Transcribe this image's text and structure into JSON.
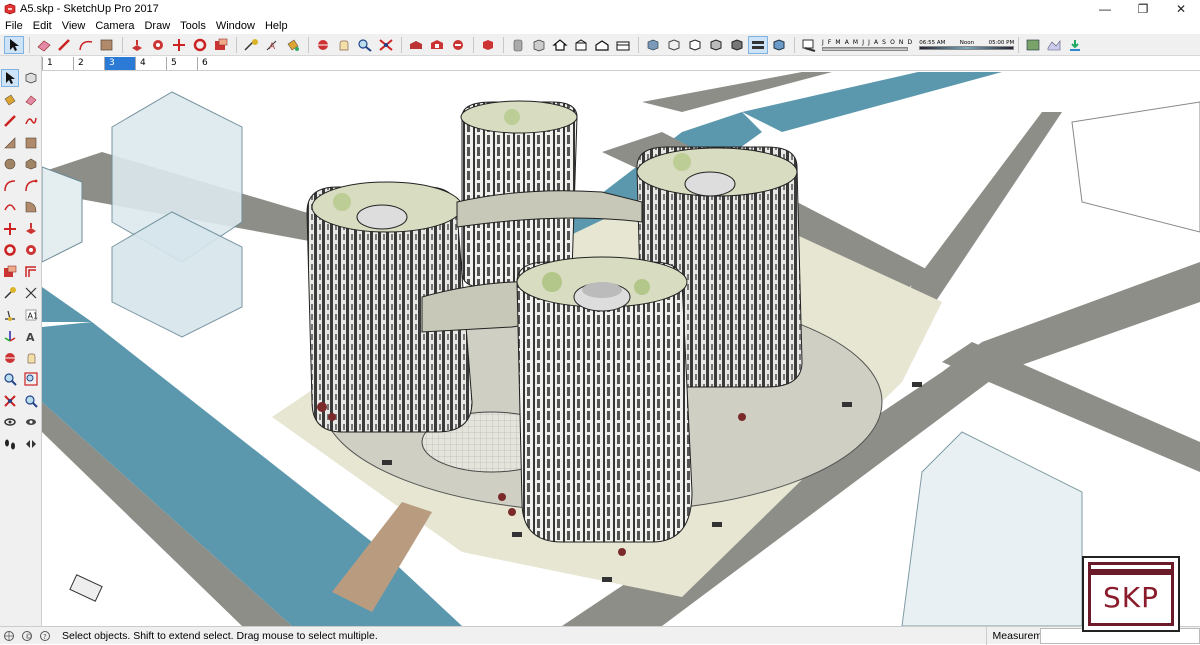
{
  "window": {
    "title": "A5.skp - SketchUp Pro 2017",
    "minimize": "—",
    "maximize": "❐",
    "close": "✕"
  },
  "menu": [
    "File",
    "Edit",
    "View",
    "Camera",
    "Draw",
    "Tools",
    "Window",
    "Help"
  ],
  "scenes": {
    "tabs": [
      "1",
      "2",
      "3",
      "4",
      "5",
      "6"
    ],
    "active_index": 2
  },
  "shadow_settings": {
    "months": "J F M A M J J A S O N D",
    "time_start": "06:55 AM",
    "time_mid": "Noon",
    "time_end": "05:00 PM"
  },
  "status": {
    "hint": "Select objects. Shift to extend select. Drag mouse to select multiple.",
    "measurements_label": "Measurements",
    "measurements_value": ""
  },
  "toolbar_icons": [
    "select-icon",
    "eraser-icon",
    "pencil-icon",
    "arc-icon",
    "shape-icon",
    "push-pull-icon",
    "follow-me-icon",
    "move-icon",
    "rotate-icon",
    "scale-icon",
    "tape-measure-icon",
    "text-icon",
    "paint-bucket-icon",
    "orbit-icon",
    "pan-icon",
    "zoom-icon",
    "zoom-extents-icon",
    "warehouse-icon",
    "extension-icon",
    "share-icon",
    "components-icon",
    "layers-icon",
    "house-icon",
    "front-view-icon",
    "back-view-icon",
    "top-view-icon",
    "xray-icon",
    "wireframe-icon",
    "hidden-line-icon",
    "shaded-icon",
    "textured-icon",
    "monochrome-icon",
    "shadows-icon",
    "fog-icon",
    "section-icon",
    "sandbox-icon",
    "download-icon"
  ],
  "left_tools": [
    "select-icon",
    "make-component-icon",
    "paint-bucket-icon",
    "eraser-icon",
    "pencil-icon",
    "freehand-icon",
    "rectangle-icon",
    "rotated-rectangle-icon",
    "circle-icon",
    "polygon-icon",
    "arc-icon",
    "pie-icon",
    "two-point-arc-icon",
    "three-point-arc-icon",
    "move-icon",
    "push-pull-icon",
    "rotate-icon",
    "follow-me-icon",
    "scale-icon",
    "offset-icon",
    "tape-measure-icon",
    "dimension-icon",
    "protractor-icon",
    "text-icon",
    "axes-icon",
    "3d-text-icon",
    "orbit-icon",
    "pan-icon",
    "zoom-icon",
    "zoom-window-icon",
    "zoom-extents-icon",
    "previous-icon",
    "position-camera-icon",
    "look-around-icon",
    "walk-icon",
    "section-plane-icon"
  ],
  "logo_text": "SKP",
  "colors": {
    "water": "#4a8fa8",
    "road": "#9a9a94",
    "plaza": "#e8e8d6",
    "selection": "#2a7ad6",
    "logo": "#8a1c2c"
  }
}
